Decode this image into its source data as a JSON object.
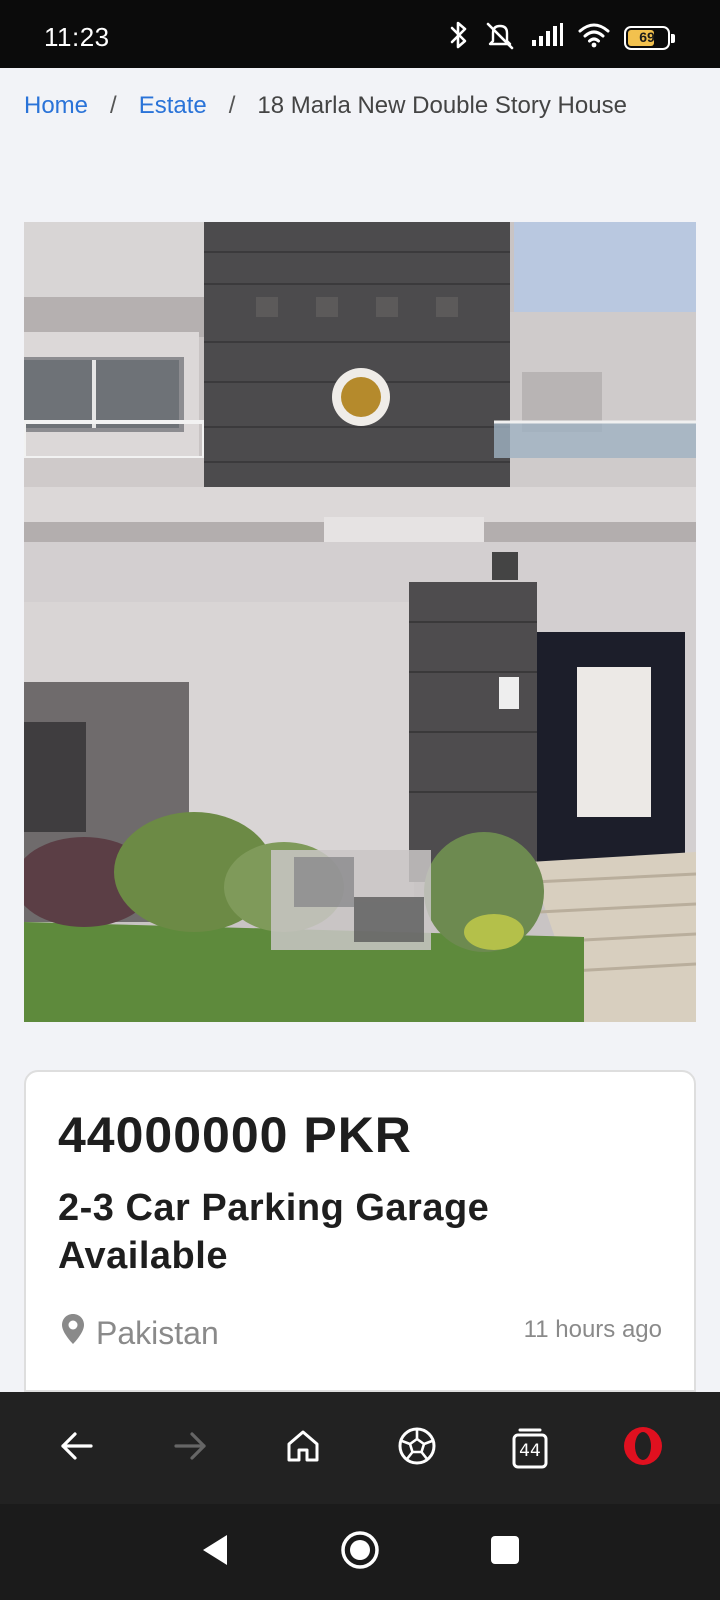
{
  "status_bar": {
    "time": "11:23",
    "battery_level": "69",
    "battery_fraction": 0.69,
    "icons": [
      "bluetooth-icon",
      "silent-icon",
      "signal-icon",
      "wifi-icon",
      "battery-icon"
    ]
  },
  "breadcrumb": {
    "home": "Home",
    "separator": "/",
    "category": "Estate",
    "current": "18 Marla New Double Story House"
  },
  "listing": {
    "price": "44000000 PKR",
    "title": "2-3 Car Parking Garage Available",
    "location": "Pakistan",
    "posted": "11 hours ago"
  },
  "browser_bar": {
    "tab_count": "44",
    "icons": [
      "back-arrow-icon",
      "forward-arrow-icon",
      "home-icon",
      "soccer-ball-icon",
      "tabs-icon",
      "opera-logo-icon"
    ]
  },
  "system_nav": {
    "icons": [
      "system-back-icon",
      "system-home-icon",
      "system-recents-icon"
    ]
  },
  "colors": {
    "link": "#2a73d8",
    "opera_red": "#e0101f",
    "battery_fill": "#f2c14e"
  }
}
